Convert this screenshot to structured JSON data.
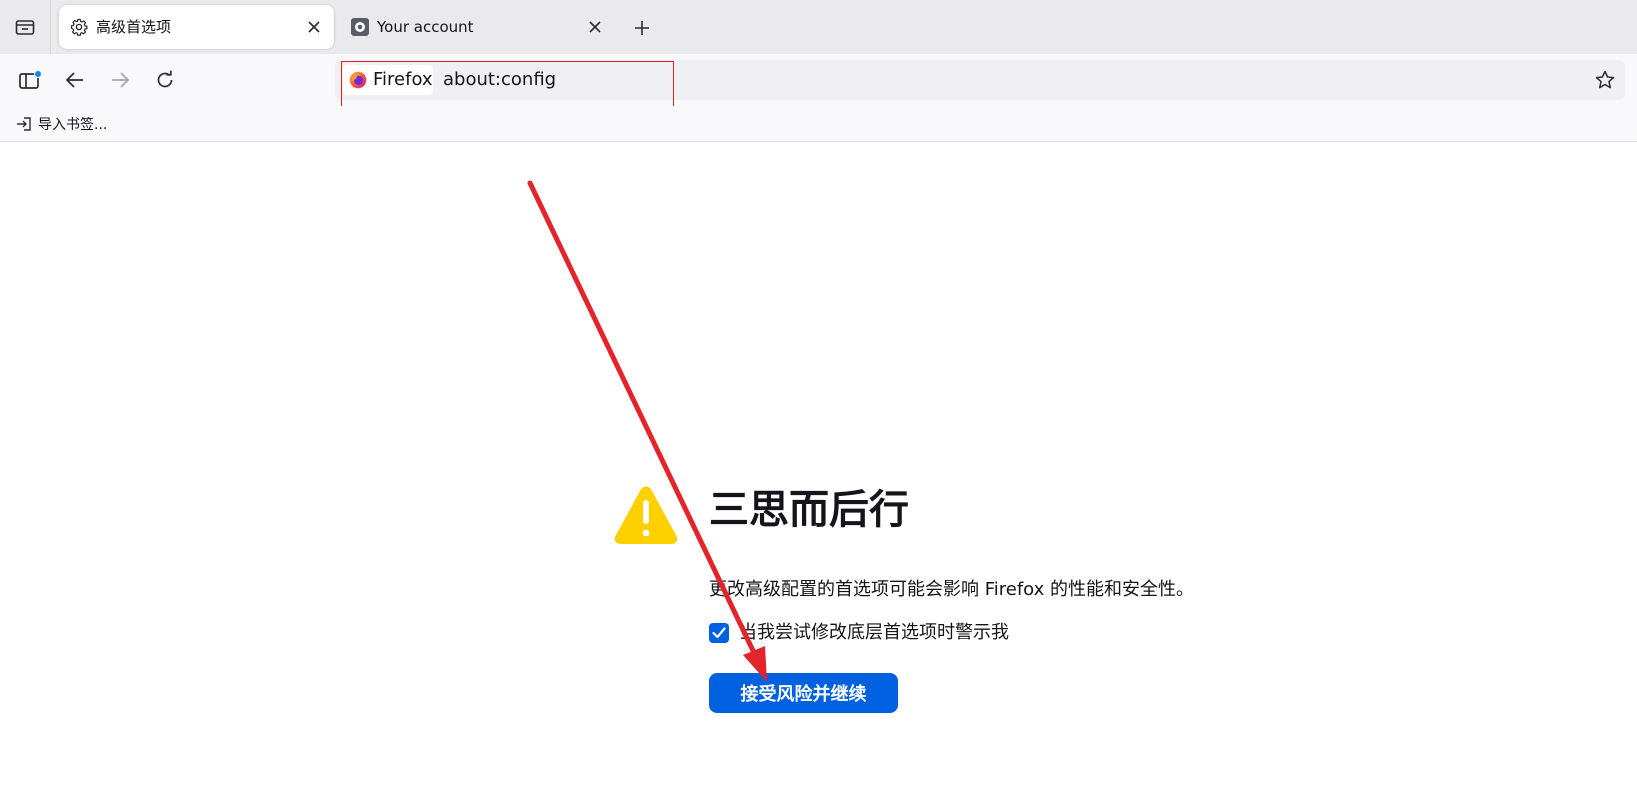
{
  "tabs": [
    {
      "title": "高级首选项",
      "icon": "gear-icon",
      "active": true
    },
    {
      "title": "Your account",
      "icon": "account-icon",
      "active": false
    }
  ],
  "urlbar": {
    "identity_label": "Firefox",
    "url": "about:config"
  },
  "bookmarks": {
    "import_label": "导入书签..."
  },
  "warning": {
    "title": "三思而后行",
    "description": "更改高级配置的首选项可能会影响 Firefox 的性能和安全性。",
    "checkbox_label": "当我尝试修改底层首选项时警示我",
    "checkbox_checked": true,
    "accept_button_label": "接受风险并继续"
  },
  "colors": {
    "accent": "#0061e0",
    "warning_yellow": "#ffd000",
    "annotation_red": "#e3242b"
  }
}
